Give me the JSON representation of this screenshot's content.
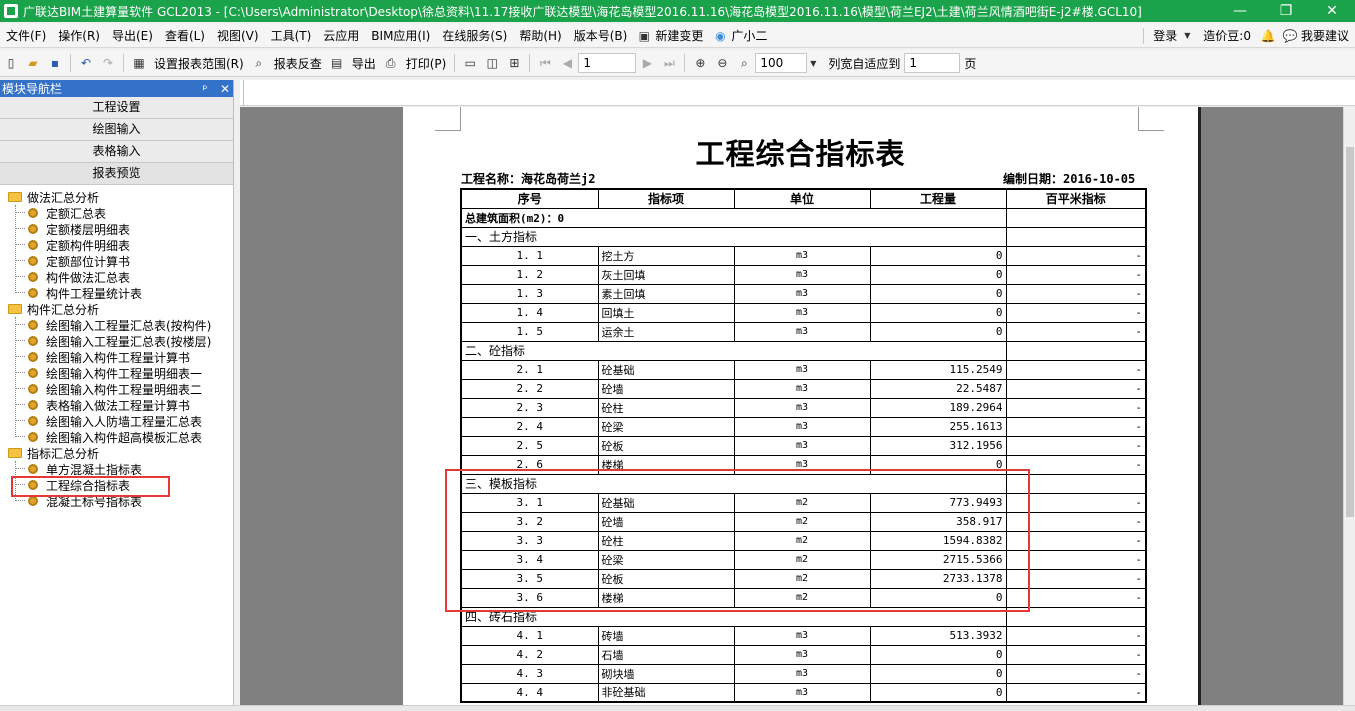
{
  "window": {
    "title": "广联达BIM土建算量软件 GCL2013 - [C:\\Users\\Administrator\\Desktop\\徐总资料\\11.17接收广联达模型\\海花岛模型2016.11.16\\海花岛模型2016.11.16\\模型\\荷兰EJ2\\土建\\荷兰风情酒吧街E-j2#楼.GCL10]",
    "minimize": "—",
    "restore": "❐",
    "close": "✕"
  },
  "menu": {
    "items": [
      "文件(F)",
      "操作(R)",
      "导出(E)",
      "查看(L)",
      "视图(V)",
      "工具(T)",
      "云应用",
      "BIM应用(I)",
      "在线服务(S)",
      "帮助(H)",
      "版本号(B)"
    ],
    "new_change": "新建变更",
    "assistant": "广小二",
    "login": "登录",
    "beans": "造价豆:0",
    "feedback": "我要建议"
  },
  "toolbar": {
    "set_range": "设置报表范围(R)",
    "check_report": "报表反查",
    "export": "导出",
    "print": "打印(P)",
    "page_number": "1",
    "zoom": "100",
    "fit_label": "列宽自适应到",
    "fit_value": "1",
    "page_unit": "页"
  },
  "panel": {
    "title": "模块导航栏",
    "pin": "ᵖ",
    "close": "✕",
    "nav_buttons": [
      "工程设置",
      "绘图输入",
      "表格输入",
      "报表预览"
    ],
    "groups": [
      {
        "label": "做法汇总分析",
        "items": [
          "定额汇总表",
          "定额楼层明细表",
          "定额构件明细表",
          "定额部位计算书",
          "构件做法汇总表",
          "构件工程量统计表"
        ]
      },
      {
        "label": "构件汇总分析",
        "items": [
          "绘图输入工程量汇总表(按构件)",
          "绘图输入工程量汇总表(按楼层)",
          "绘图输入构件工程量计算书",
          "绘图输入构件工程量明细表一",
          "绘图输入构件工程量明细表二",
          "表格输入做法工程量计算书",
          "绘图输入人防墙工程量汇总表",
          "绘图输入构件超高模板汇总表"
        ]
      },
      {
        "label": "指标汇总分析",
        "items": [
          "单方混凝土指标表",
          "工程综合指标表",
          "混凝土标号指标表"
        ]
      }
    ]
  },
  "report": {
    "title": "工程综合指标表",
    "project": "工程名称：海花岛荷兰j2",
    "date": "编制日期：2016-10-05",
    "headers": [
      "序号",
      "指标项",
      "单位",
      "工程量",
      "百平米指标"
    ],
    "total_area": "总建筑面积(m2)：0",
    "sections": [
      {
        "title": "一、土方指标",
        "rows": [
          [
            "1. 1",
            "挖土方",
            "m3",
            "0",
            "-"
          ],
          [
            "1. 2",
            "灰土回填",
            "m3",
            "0",
            "-"
          ],
          [
            "1. 3",
            "素土回填",
            "m3",
            "0",
            "-"
          ],
          [
            "1. 4",
            "回填土",
            "m3",
            "0",
            "-"
          ],
          [
            "1. 5",
            "运余土",
            "m3",
            "0",
            "-"
          ]
        ]
      },
      {
        "title": "二、砼指标",
        "rows": [
          [
            "2. 1",
            "砼基础",
            "m3",
            "115.2549",
            "-"
          ],
          [
            "2. 2",
            "砼墙",
            "m3",
            "22.5487",
            "-"
          ],
          [
            "2. 3",
            "砼柱",
            "m3",
            "189.2964",
            "-"
          ],
          [
            "2. 4",
            "砼梁",
            "m3",
            "255.1613",
            "-"
          ],
          [
            "2. 5",
            "砼板",
            "m3",
            "312.1956",
            "-"
          ],
          [
            "2. 6",
            "楼梯",
            "m3",
            "0",
            "-"
          ]
        ]
      },
      {
        "title": "三、模板指标",
        "rows": [
          [
            "3. 1",
            "砼基础",
            "m2",
            "773.9493",
            "-"
          ],
          [
            "3. 2",
            "砼墙",
            "m2",
            "358.917",
            "-"
          ],
          [
            "3. 3",
            "砼柱",
            "m2",
            "1594.8382",
            "-"
          ],
          [
            "3. 4",
            "砼梁",
            "m2",
            "2715.5366",
            "-"
          ],
          [
            "3. 5",
            "砼板",
            "m2",
            "2733.1378",
            "-"
          ],
          [
            "3. 6",
            "楼梯",
            "m2",
            "0",
            "-"
          ]
        ]
      },
      {
        "title": "四、砖石指标",
        "rows": [
          [
            "4. 1",
            "砖墙",
            "m3",
            "513.3932",
            "-"
          ],
          [
            "4. 2",
            "石墙",
            "m3",
            "0",
            "-"
          ],
          [
            "4. 3",
            "砌块墙",
            "m3",
            "0",
            "-"
          ],
          [
            "4. 4",
            "非砼基础",
            "m3",
            "0",
            "-"
          ]
        ]
      }
    ]
  }
}
